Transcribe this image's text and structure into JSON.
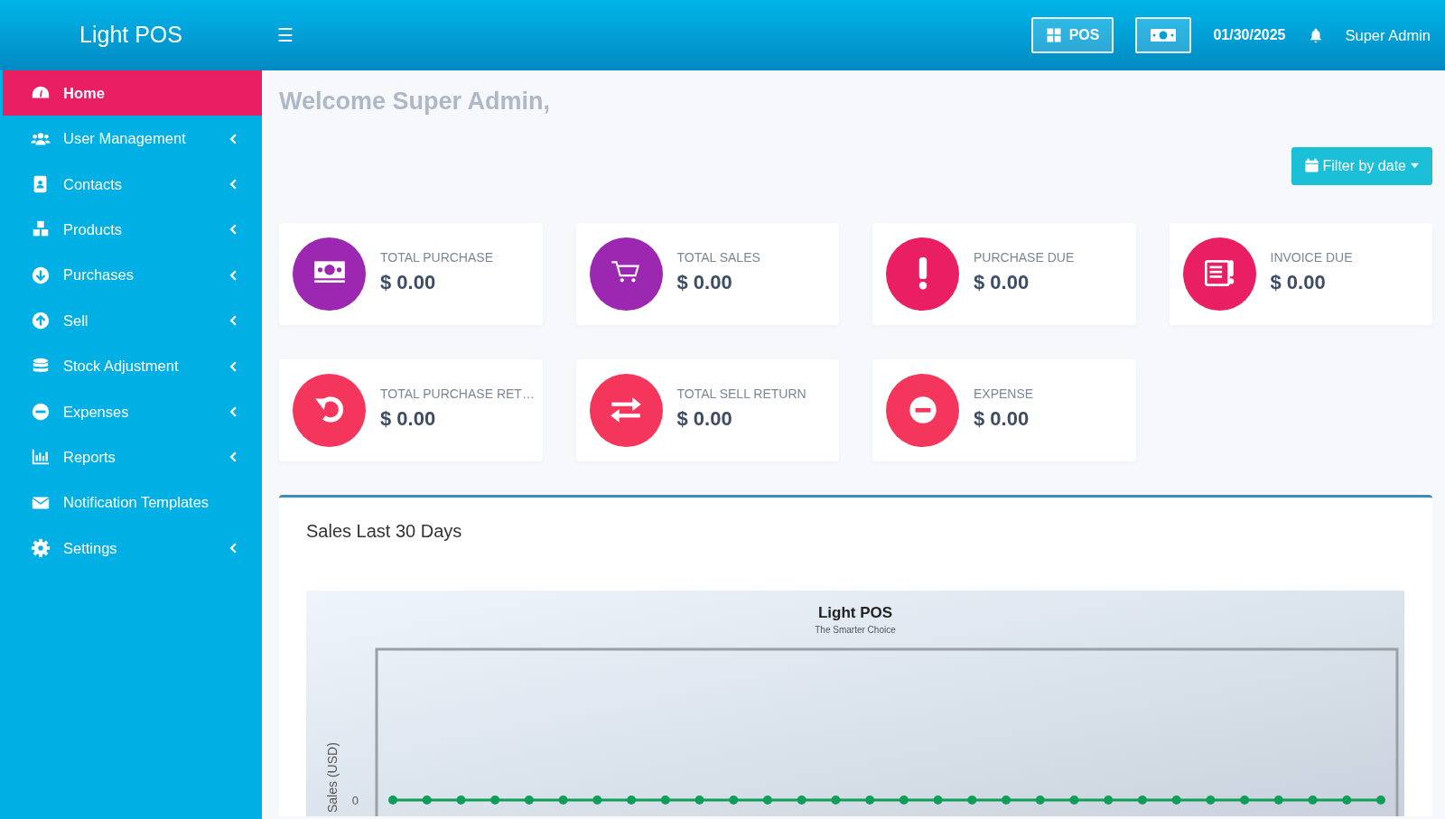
{
  "header": {
    "logo": "Light POS",
    "menu_icon": "☰",
    "pos_button": "POS",
    "date": "01/30/2025",
    "user": "Super Admin"
  },
  "sidebar": {
    "items": [
      {
        "label": "Home",
        "selected": true,
        "expandable": false
      },
      {
        "label": "User Management",
        "selected": false,
        "expandable": true
      },
      {
        "label": "Contacts",
        "selected": false,
        "expandable": true
      },
      {
        "label": "Products",
        "selected": false,
        "expandable": true
      },
      {
        "label": "Purchases",
        "selected": false,
        "expandable": true
      },
      {
        "label": "Sell",
        "selected": false,
        "expandable": true
      },
      {
        "label": "Stock Adjustment",
        "selected": false,
        "expandable": true
      },
      {
        "label": "Expenses",
        "selected": false,
        "expandable": true
      },
      {
        "label": "Reports",
        "selected": false,
        "expandable": true
      },
      {
        "label": "Notification Templates",
        "selected": false,
        "expandable": false
      },
      {
        "label": "Settings",
        "selected": false,
        "expandable": true
      }
    ]
  },
  "welcome": "Welcome Super Admin,",
  "filter_button": "Filter by date",
  "stats": [
    {
      "label": "TOTAL PURCHASE",
      "value": "$ 0.00",
      "color": "#9c27b0"
    },
    {
      "label": "TOTAL SALES",
      "value": "$ 0.00",
      "color": "#9c27b0"
    },
    {
      "label": "PURCHASE DUE",
      "value": "$ 0.00",
      "color": "#e91e63"
    },
    {
      "label": "INVOICE DUE",
      "value": "$ 0.00",
      "color": "#e91e63"
    },
    {
      "label": "TOTAL PURCHASE RET…",
      "value": "$ 0.00",
      "color": "#f5365c"
    },
    {
      "label": "TOTAL SELL RETURN",
      "value": "$ 0.00",
      "color": "#f5365c"
    },
    {
      "label": "EXPENSE",
      "value": "$ 0.00",
      "color": "#f5365c"
    }
  ],
  "sales_chart": {
    "heading": "Sales Last 30 Days",
    "title": "Light POS",
    "subtitle": "The Smarter Choice",
    "ylabel": "Sales (USD)",
    "y_tick": "0"
  }
}
